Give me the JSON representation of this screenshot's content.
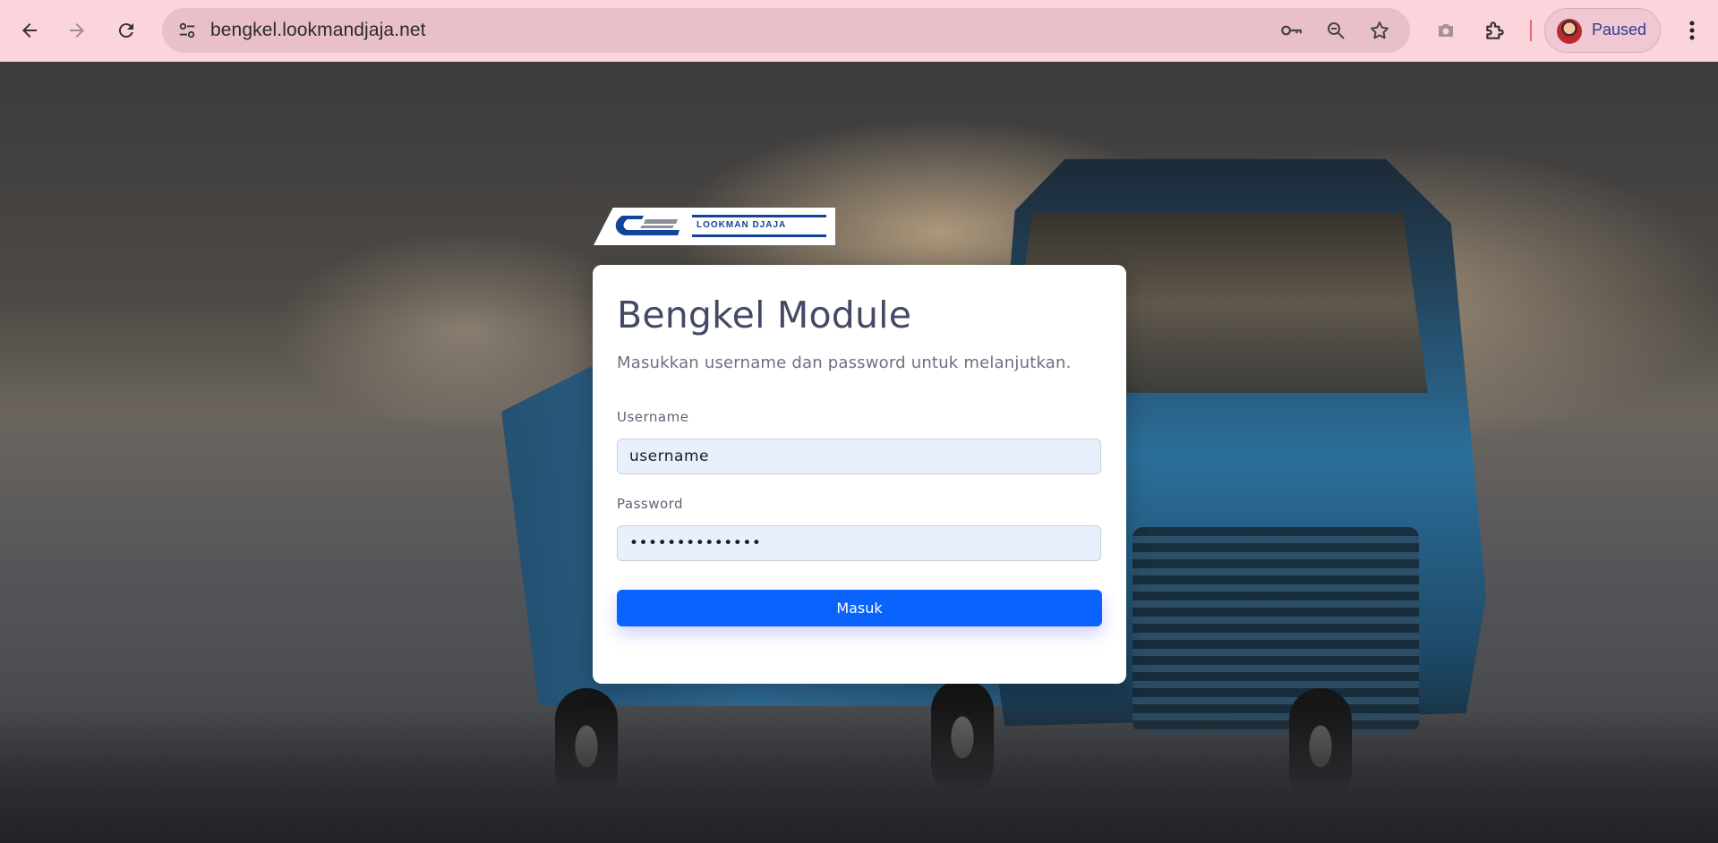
{
  "browser": {
    "url": "bengkel.lookmandjaja.net",
    "profile_label": "Paused",
    "icons": {
      "back": "arrow-left-icon",
      "forward": "arrow-right-icon",
      "reload": "reload-icon",
      "site_settings": "tune-icon",
      "password": "key-icon",
      "zoom": "zoom-icon",
      "bookmark": "star-icon",
      "screenshot": "camera-icon",
      "extensions": "puzzle-icon",
      "menu": "kebab-menu-icon"
    }
  },
  "logo": {
    "text": "LOOKMAN DJAJA"
  },
  "login": {
    "title": "Bengkel Module",
    "subtitle": "Masukkan username dan password untuk melanjutkan.",
    "username_label": "Username",
    "username_value": "username",
    "password_label": "Password",
    "password_value": "••••••••••••••",
    "submit_label": "Masuk"
  },
  "colors": {
    "toolbar": "#fbd4dc",
    "primary_button": "#0a63fc",
    "input_autofill": "#e8f0fe",
    "brand_blue": "#11449a"
  }
}
